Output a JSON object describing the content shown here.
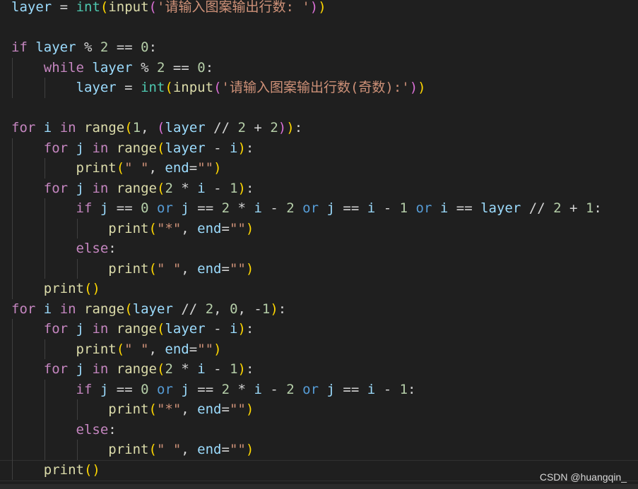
{
  "editor": {
    "language": "python",
    "colors": {
      "background": "#1f1f1f",
      "keyword": "#c586c0",
      "function": "#dcdcaa",
      "builtin": "#4ec9b0",
      "variable": "#9cdcfe",
      "number": "#b5cea8",
      "string": "#ce9178",
      "operator_word": "#569cd6"
    },
    "lines": [
      "layer = int(input('请输入图案输出行数: '))",
      "",
      "if layer % 2 == 0:",
      "    while layer % 2 == 0:",
      "        layer = int(input('请输入图案输出行数(奇数):'))",
      "",
      "for i in range(1, (layer // 2 + 2)):",
      "    for j in range(layer - i):",
      "        print(\" \", end=\"\")",
      "    for j in range(2 * i - 1):",
      "        if j == 0 or j == 2 * i - 2 or j == i - 1 or i == layer // 2 + 1:",
      "            print(\"*\", end=\"\")",
      "        else:",
      "            print(\" \", end=\"\")",
      "    print()",
      "for i in range(layer // 2, 0, -1):",
      "    for j in range(layer - i):",
      "        print(\" \", end=\"\")",
      "    for j in range(2 * i - 1):",
      "        if j == 0 or j == 2 * i - 2 or j == i - 1:",
      "            print(\"*\", end=\"\")",
      "        else:",
      "            print(\" \", end=\"\")",
      "    print()"
    ]
  },
  "watermark": "CSDN @huangqin_"
}
